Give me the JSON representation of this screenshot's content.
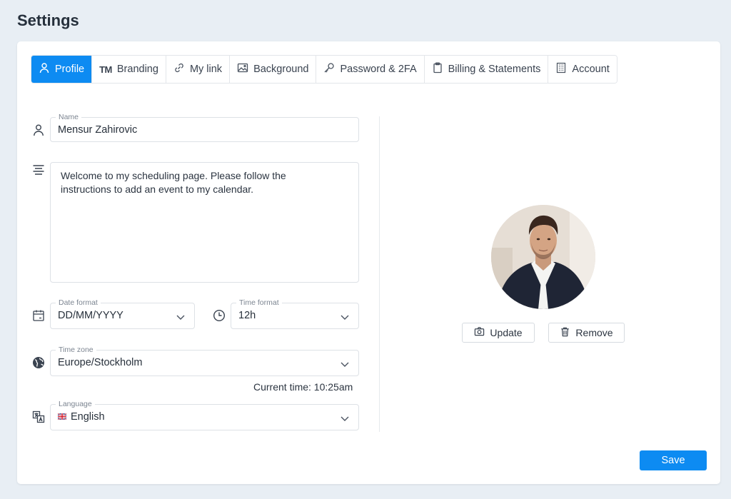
{
  "page": {
    "title": "Settings"
  },
  "tabs": [
    {
      "label": "Profile",
      "icon": "user-icon",
      "active": true
    },
    {
      "label": "Branding",
      "icon": "trademark-icon"
    },
    {
      "label": "My link",
      "icon": "link-icon"
    },
    {
      "label": "Background",
      "icon": "image-icon"
    },
    {
      "label": "Password & 2FA",
      "icon": "key-icon"
    },
    {
      "label": "Billing & Statements",
      "icon": "clipboard-icon"
    },
    {
      "label": "Account",
      "icon": "building-icon"
    }
  ],
  "trademark_glyph": "TM",
  "form": {
    "name": {
      "label": "Name",
      "value": "Mensur Zahirovic"
    },
    "bio": {
      "value": "Welcome to my scheduling page. Please follow the instructions to add an event to my calendar."
    },
    "date_format": {
      "label": "Date format",
      "value": "DD/MM/YYYY"
    },
    "time_format": {
      "label": "Time format",
      "value": "12h"
    },
    "time_zone": {
      "label": "Time zone",
      "value": "Europe/Stockholm"
    },
    "current_time": "Current time: 10:25am",
    "language": {
      "label": "Language",
      "value": "English"
    }
  },
  "avatar": {
    "update_label": "Update",
    "remove_label": "Remove"
  },
  "actions": {
    "save_label": "Save"
  },
  "colors": {
    "accent": "#0d8bf2",
    "background": "#e8eef4"
  }
}
